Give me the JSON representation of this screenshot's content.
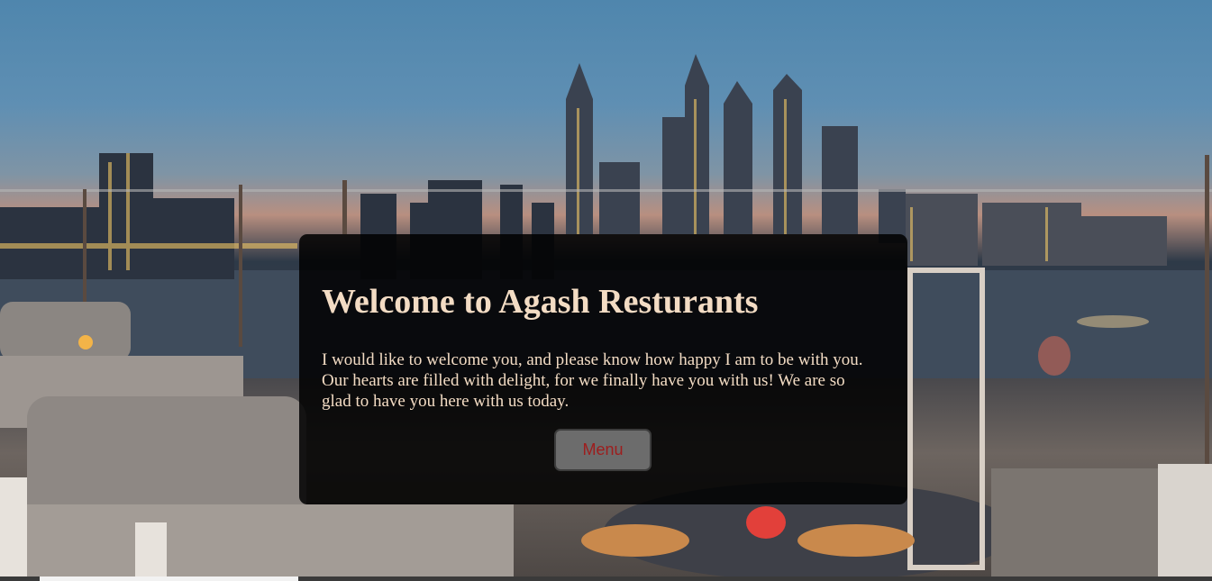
{
  "hero": {
    "title": "Welcome to Agash Resturants",
    "message": "I would like to welcome you, and please know how happy I am to be with you. Our hearts are filled with delight, for we finally have you with us! We are so glad to have you here with us today.",
    "menu_label": "Menu"
  },
  "colors": {
    "heading_text": "#f3dcc4",
    "card_background": "#000000",
    "button_background": "#6c6c6c",
    "button_text": "#9e1d1d"
  }
}
